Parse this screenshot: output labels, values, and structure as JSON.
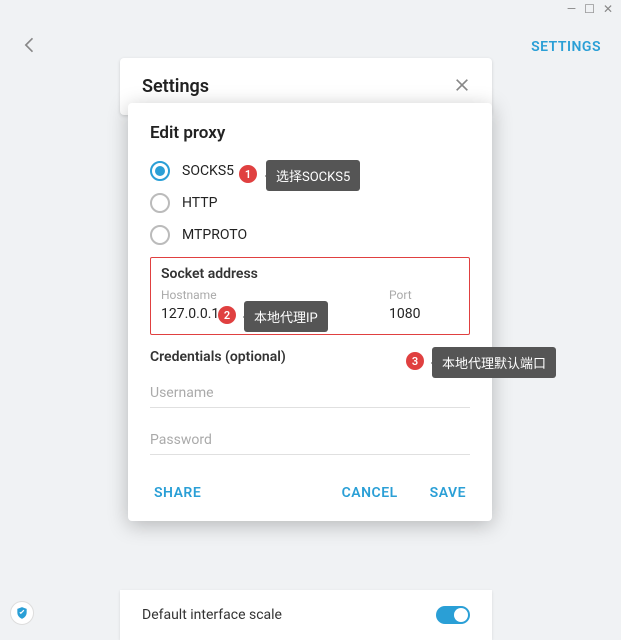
{
  "window": {
    "min": "—",
    "max": "☐",
    "close": "✕"
  },
  "topbar": {
    "settings_link": "SETTINGS"
  },
  "settings_panel": {
    "title": "Settings"
  },
  "bottom": {
    "scale_label": "Default interface scale"
  },
  "modal": {
    "title": "Edit proxy",
    "options": {
      "socks5": "SOCKS5",
      "http": "HTTP",
      "mtproto": "MTPROTO"
    },
    "socket": {
      "title": "Socket address",
      "hostname_label": "Hostname",
      "hostname_value": "127.0.0.1",
      "port_label": "Port",
      "port_value": "1080"
    },
    "creds": {
      "title": "Credentials (optional)",
      "username_ph": "Username",
      "password_ph": "Password"
    },
    "footer": {
      "share": "SHARE",
      "cancel": "CANCEL",
      "save": "SAVE"
    }
  },
  "callouts": {
    "n1": "1",
    "t1": "选择SOCKS5",
    "n2": "2",
    "t2": "本地代理IP",
    "n3": "3",
    "t3": "本地代理默认端口"
  }
}
